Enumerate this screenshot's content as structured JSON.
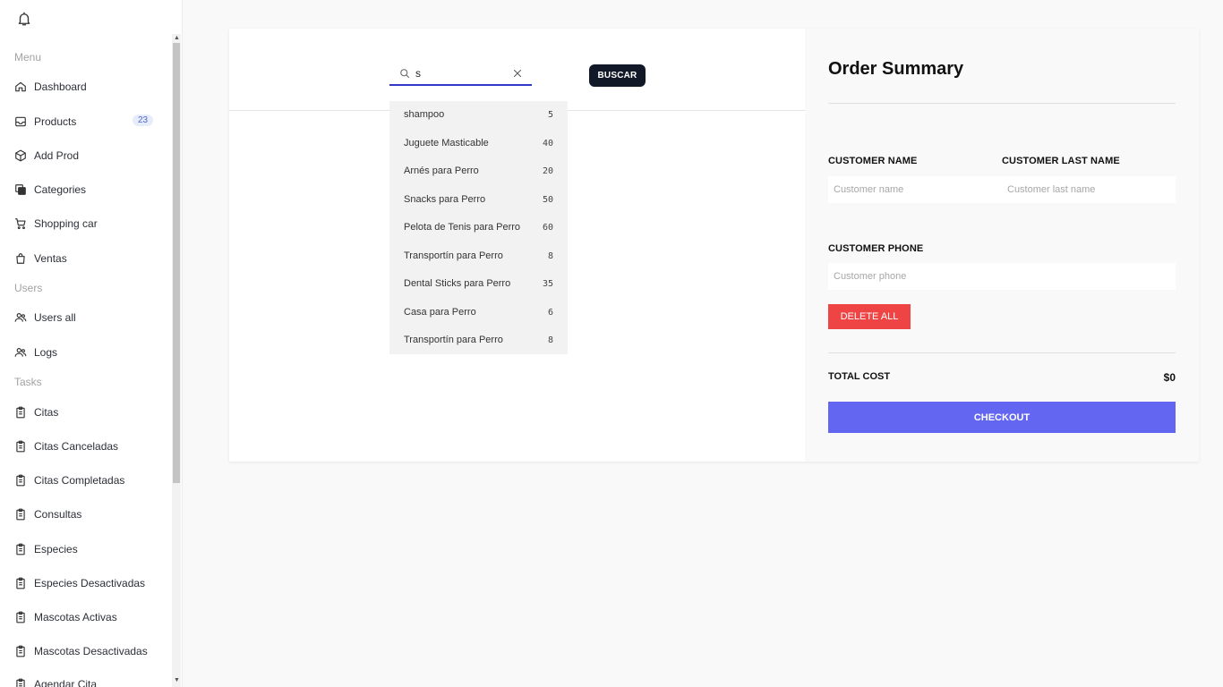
{
  "sidebar": {
    "sections": {
      "menu": "Menu",
      "users": "Users",
      "tasks": "Tasks"
    },
    "items": [
      {
        "label": "Dashboard",
        "icon": "home-icon"
      },
      {
        "label": "Products",
        "icon": "inbox-icon",
        "badge": "23"
      },
      {
        "label": "Add Prod",
        "icon": "cube-icon"
      },
      {
        "label": "Categories",
        "icon": "layers-icon"
      },
      {
        "label": "Shopping car",
        "icon": "cart-icon"
      },
      {
        "label": "Ventas",
        "icon": "shopping-bag-icon"
      },
      {
        "label": "Users all",
        "icon": "users-icon"
      },
      {
        "label": "Logs",
        "icon": "users-icon"
      },
      {
        "label": "Citas",
        "icon": "clipboard-icon"
      },
      {
        "label": "Citas Canceladas",
        "icon": "clipboard-icon"
      },
      {
        "label": "Citas Completadas",
        "icon": "clipboard-icon"
      },
      {
        "label": "Consultas",
        "icon": "clipboard-icon"
      },
      {
        "label": "Especies",
        "icon": "clipboard-icon"
      },
      {
        "label": "Especies Desactivadas",
        "icon": "clipboard-icon"
      },
      {
        "label": "Mascotas Activas",
        "icon": "clipboard-icon"
      },
      {
        "label": "Mascotas Desactivadas",
        "icon": "clipboard-icon"
      },
      {
        "label": "Agendar Cita",
        "icon": "clipboard-icon"
      }
    ]
  },
  "search": {
    "value": "s",
    "button_label": "BUSCAR",
    "results": [
      {
        "name": "shampoo",
        "count": "5"
      },
      {
        "name": "Juguete Masticable",
        "count": "40"
      },
      {
        "name": "Arnés para Perro",
        "count": "20"
      },
      {
        "name": "Snacks para Perro",
        "count": "50"
      },
      {
        "name": "Pelota de Tenis para Perro",
        "count": "60"
      },
      {
        "name": "Transportín para Perro",
        "count": "8"
      },
      {
        "name": "Dental Sticks para Perro",
        "count": "35"
      },
      {
        "name": "Casa para Perro",
        "count": "6"
      },
      {
        "name": "Transportín para Perro",
        "count": "8"
      }
    ]
  },
  "order": {
    "title": "Order Summary",
    "customer_name_label": "CUSTOMER NAME",
    "customer_name_placeholder": "Customer name",
    "customer_last_name_label": "CUSTOMER LAST NAME",
    "customer_last_name_placeholder": "Customer last name",
    "customer_phone_label": "CUSTOMER PHONE",
    "customer_phone_placeholder": "Customer phone",
    "delete_all_label": "DELETE ALL",
    "total_label": "TOTAL COST",
    "total_value": "$0",
    "checkout_label": "CHECKOUT"
  },
  "colors": {
    "primary": "#6366f1",
    "danger": "#ef4444",
    "dark_button": "#111827",
    "search_underline": "#3137c9"
  }
}
